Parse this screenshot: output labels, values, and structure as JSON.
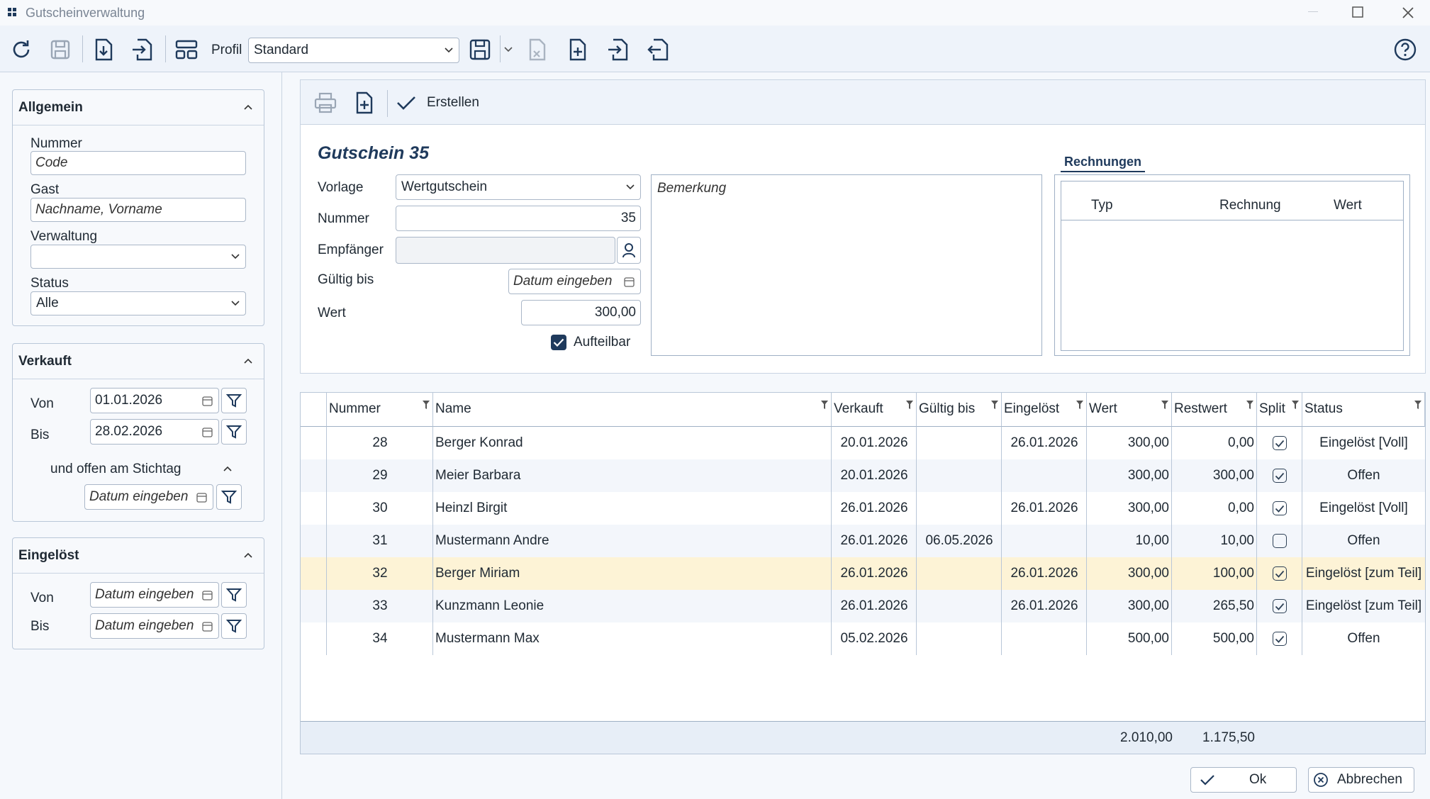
{
  "window": {
    "title": "Gutscheinverwaltung"
  },
  "toolbar": {
    "profile_label": "Profil",
    "profile_value": "Standard"
  },
  "sidebar": {
    "allgemein": {
      "title": "Allgemein",
      "nummer_label": "Nummer",
      "nummer_placeholder": "Code",
      "gast_label": "Gast",
      "gast_placeholder": "Nachname, Vorname",
      "verwaltung_label": "Verwaltung",
      "verwaltung_value": "",
      "status_label": "Status",
      "status_value": "Alle"
    },
    "verkauft": {
      "title": "Verkauft",
      "von_label": "Von",
      "von_value": "01.01.2026",
      "bis_label": "Bis",
      "bis_value": "28.02.2026",
      "offen_label": "und offen am Stichtag",
      "stichtag_placeholder": "Datum eingeben"
    },
    "eingeloest": {
      "title": "Eingelöst",
      "von_label": "Von",
      "von_placeholder": "Datum eingeben",
      "bis_label": "Bis",
      "bis_placeholder": "Datum eingeben"
    }
  },
  "main_toolbar": {
    "create_label": "Erstellen"
  },
  "form": {
    "title": "Gutschein 35",
    "vorlage_label": "Vorlage",
    "vorlage_value": "Wertgutschein",
    "nummer_label": "Nummer",
    "nummer_value": "35",
    "empfaenger_label": "Empfänger",
    "empfaenger_value": "",
    "gueltig_label": "Gültig bis",
    "gueltig_placeholder": "Datum eingeben",
    "wert_label": "Wert",
    "wert_value": "300,00",
    "aufteilbar_label": "Aufteilbar",
    "aufteilbar_checked": true,
    "bemerkung_placeholder": "Bemerkung",
    "rechnungen": {
      "tab_label": "Rechnungen",
      "col_typ": "Typ",
      "col_rechnung": "Rechnung",
      "col_wert": "Wert"
    }
  },
  "grid": {
    "columns": [
      "Nummer",
      "Name",
      "Verkauft",
      "Gültig bis",
      "Eingelöst",
      "Wert",
      "Restwert",
      "Split",
      "Status"
    ],
    "rows": [
      {
        "nummer": "28",
        "name": "Berger Konrad",
        "verkauft": "20.01.2026",
        "gueltig": "",
        "eingeloest": "26.01.2026",
        "wert": "300,00",
        "restwert": "0,00",
        "split": true,
        "status": "Eingelöst [Voll]"
      },
      {
        "nummer": "29",
        "name": "Meier Barbara",
        "verkauft": "20.01.2026",
        "gueltig": "",
        "eingeloest": "",
        "wert": "300,00",
        "restwert": "300,00",
        "split": true,
        "status": "Offen"
      },
      {
        "nummer": "30",
        "name": "Heinzl Birgit",
        "verkauft": "26.01.2026",
        "gueltig": "",
        "eingeloest": "26.01.2026",
        "wert": "300,00",
        "restwert": "0,00",
        "split": true,
        "status": "Eingelöst [Voll]"
      },
      {
        "nummer": "31",
        "name": "Mustermann Andre",
        "verkauft": "26.01.2026",
        "gueltig": "06.05.2026",
        "eingeloest": "",
        "wert": "10,00",
        "restwert": "10,00",
        "split": false,
        "status": "Offen"
      },
      {
        "nummer": "32",
        "name": "Berger Miriam",
        "verkauft": "26.01.2026",
        "gueltig": "",
        "eingeloest": "26.01.2026",
        "wert": "300,00",
        "restwert": "100,00",
        "split": true,
        "status": "Eingelöst [zum Teil]",
        "selected": true
      },
      {
        "nummer": "33",
        "name": "Kunzmann Leonie",
        "verkauft": "26.01.2026",
        "gueltig": "",
        "eingeloest": "26.01.2026",
        "wert": "300,00",
        "restwert": "265,50",
        "split": true,
        "status": "Eingelöst [zum Teil]"
      },
      {
        "nummer": "34",
        "name": "Mustermann Max",
        "verkauft": "05.02.2026",
        "gueltig": "",
        "eingeloest": "",
        "wert": "500,00",
        "restwert": "500,00",
        "split": true,
        "status": "Offen"
      }
    ],
    "totals": {
      "wert": "2.010,00",
      "restwert": "1.175,50"
    }
  },
  "buttons": {
    "ok": "Ok",
    "cancel": "Abbrechen"
  },
  "colors": {
    "accent": "#1f3a5c",
    "selected_row": "#fdf3d6",
    "alt_row": "#f3f6fb"
  }
}
